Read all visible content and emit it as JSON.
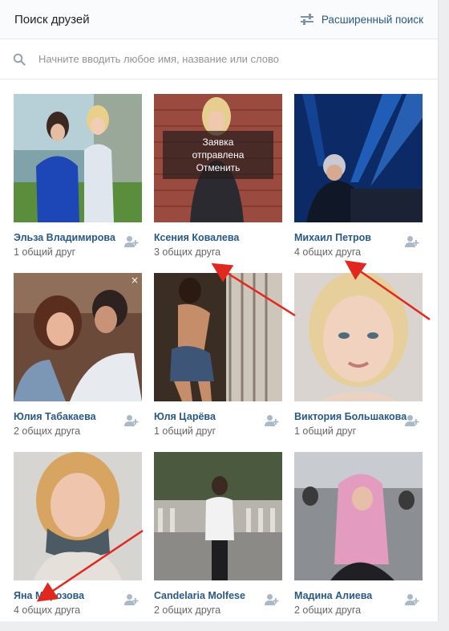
{
  "header": {
    "title": "Поиск друзей",
    "advanced_label": "Расширенный поиск"
  },
  "search": {
    "placeholder": "Начните вводить любое имя, название или слово",
    "value": ""
  },
  "colors": {
    "link": "#2a5885",
    "secondary": "#656565",
    "annotation_arrow": "#e0281f"
  },
  "people": [
    {
      "name": "Эльза Владимирова",
      "mutual": "1 общий друг"
    },
    {
      "name": "Ксения Ковалева",
      "mutual": "3 общих друга",
      "request": {
        "line1": "Заявка",
        "line2": "отправлена",
        "cancel": "Отменить"
      }
    },
    {
      "name": "Михаил Петров",
      "mutual": "4 общих друга"
    },
    {
      "name": "Юлия Табакаева",
      "mutual": "2 общих друга",
      "close_icon": "×"
    },
    {
      "name": "Юля Царёва",
      "mutual": "1 общий друг"
    },
    {
      "name": "Виктория Большакова",
      "mutual": "1 общий друг"
    },
    {
      "name": "Яна Морозова",
      "mutual": "4 общих друга"
    },
    {
      "name": "Candelaria Molfese",
      "mutual": "2 общих друга"
    },
    {
      "name": "Мадина Алиева",
      "mutual": "2 общих друга"
    }
  ]
}
